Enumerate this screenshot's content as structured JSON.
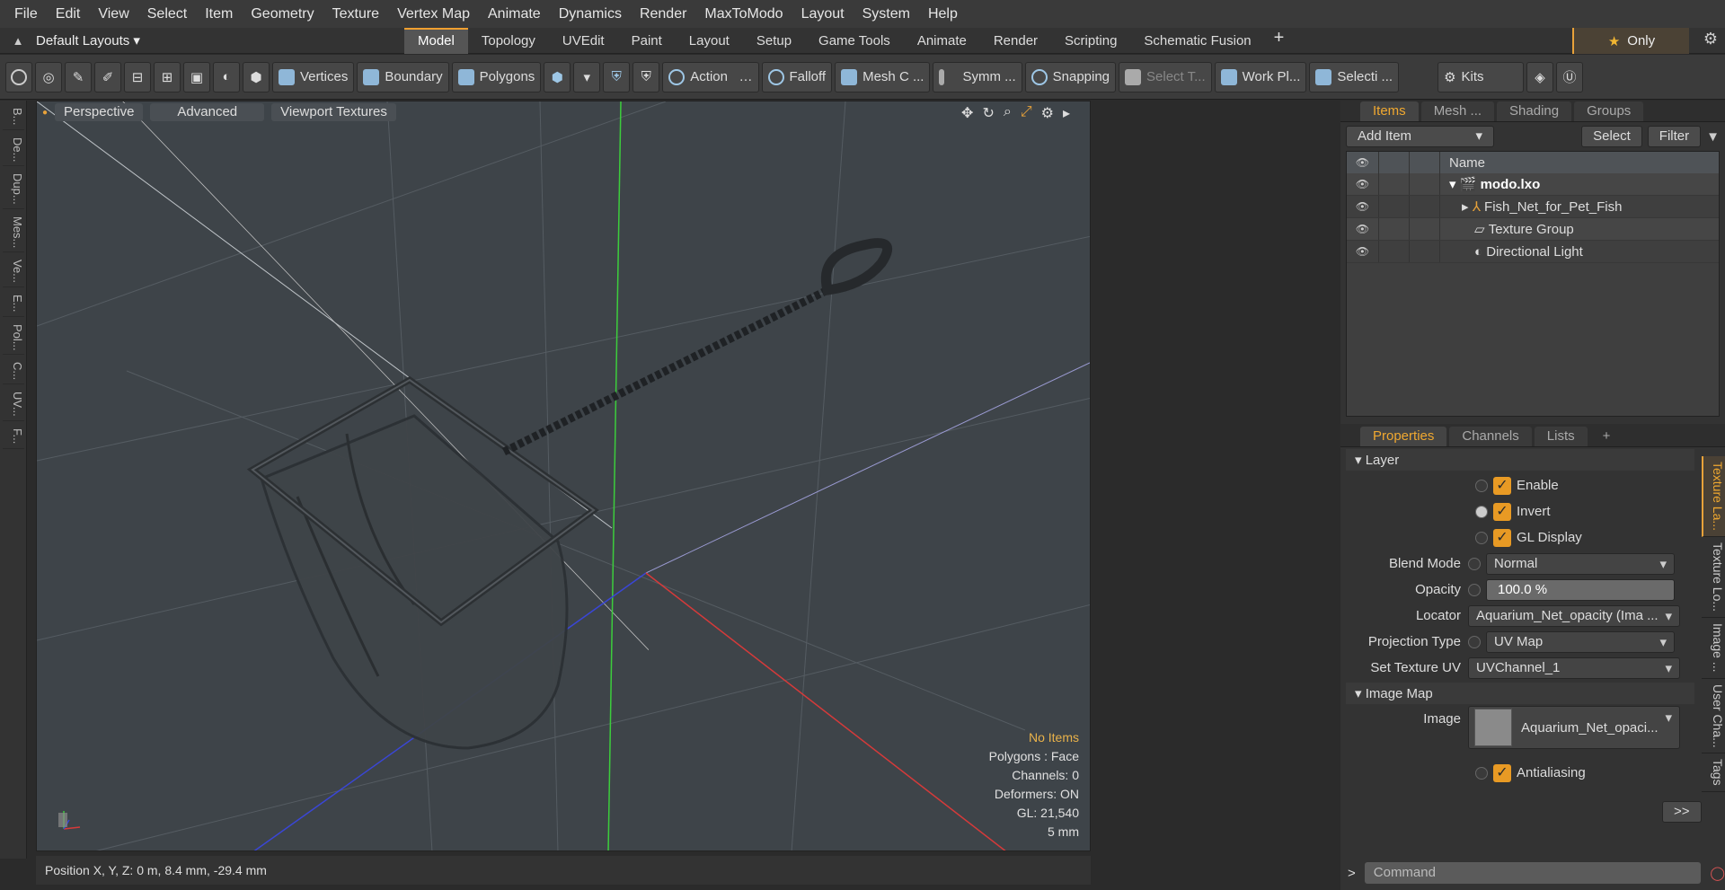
{
  "menu": [
    "File",
    "Edit",
    "View",
    "Select",
    "Item",
    "Geometry",
    "Texture",
    "Vertex Map",
    "Animate",
    "Dynamics",
    "Render",
    "MaxToModo",
    "Layout",
    "System",
    "Help"
  ],
  "layout_name": "Default Layouts",
  "tabs": [
    "Model",
    "Topology",
    "UVEdit",
    "Paint",
    "Layout",
    "Setup",
    "Game Tools",
    "Animate",
    "Render",
    "Scripting",
    "Schematic Fusion"
  ],
  "only_label": "Only",
  "toolbar": {
    "vertices": "Vertices",
    "boundary": "Boundary",
    "polygons": "Polygons",
    "action": "Action",
    "falloff": "Falloff",
    "meshc": "Mesh C ...",
    "symm": "Symm ...",
    "snapping": "Snapping",
    "selectt": "Select T...",
    "workpl": "Work Pl...",
    "selecti": "Selecti ...",
    "kits": "Kits"
  },
  "left_strip": [
    "B...",
    "De...",
    "Dup...",
    "Mes...",
    "Ve...",
    "E...",
    "Pol...",
    "C...",
    "UV...",
    "F..."
  ],
  "viewport": {
    "perspective": "Perspective",
    "advanced": "Advanced",
    "viewport_textures": "Viewport Textures",
    "stats": {
      "no_items": "No Items",
      "polygons": "Polygons : Face",
      "channels": "Channels: 0",
      "deformers": "Deformers: ON",
      "gl": "GL: 21,540",
      "scale": "5 mm"
    }
  },
  "status": "Position X, Y, Z:   0 m, 8.4 mm, -29.4 mm",
  "items_panel": {
    "tabs": [
      "Items",
      "Mesh ...",
      "Shading",
      "Groups"
    ],
    "add_item": "Add Item",
    "select": "Select",
    "filter": "Filter",
    "col_name": "Name",
    "rows": [
      "modo.lxo",
      "Fish_Net_for_Pet_Fish",
      "Texture Group",
      "Directional Light"
    ]
  },
  "props_panel": {
    "tabs": [
      "Properties",
      "Channels",
      "Lists"
    ],
    "layer": "Layer",
    "enable": "Enable",
    "invert": "Invert",
    "gl_display": "GL Display",
    "blend_mode_label": "Blend Mode",
    "blend_mode": "Normal",
    "opacity_label": "Opacity",
    "opacity": "100.0 %",
    "locator_label": "Locator",
    "locator": "Aquarium_Net_opacity (Ima ...",
    "projection_label": "Projection Type",
    "projection": "UV Map",
    "set_uv_label": "Set Texture UV",
    "set_uv": "UVChannel_1",
    "image_map": "Image Map",
    "image_label": "Image",
    "image": "Aquarium_Net_opaci...",
    "antialiasing": "Antialiasing",
    "more": ">>"
  },
  "side_tabs": [
    "Texture La...",
    "Texture Lo...",
    "Image ...",
    "User Cha...",
    "Tags"
  ],
  "command_placeholder": "Command"
}
